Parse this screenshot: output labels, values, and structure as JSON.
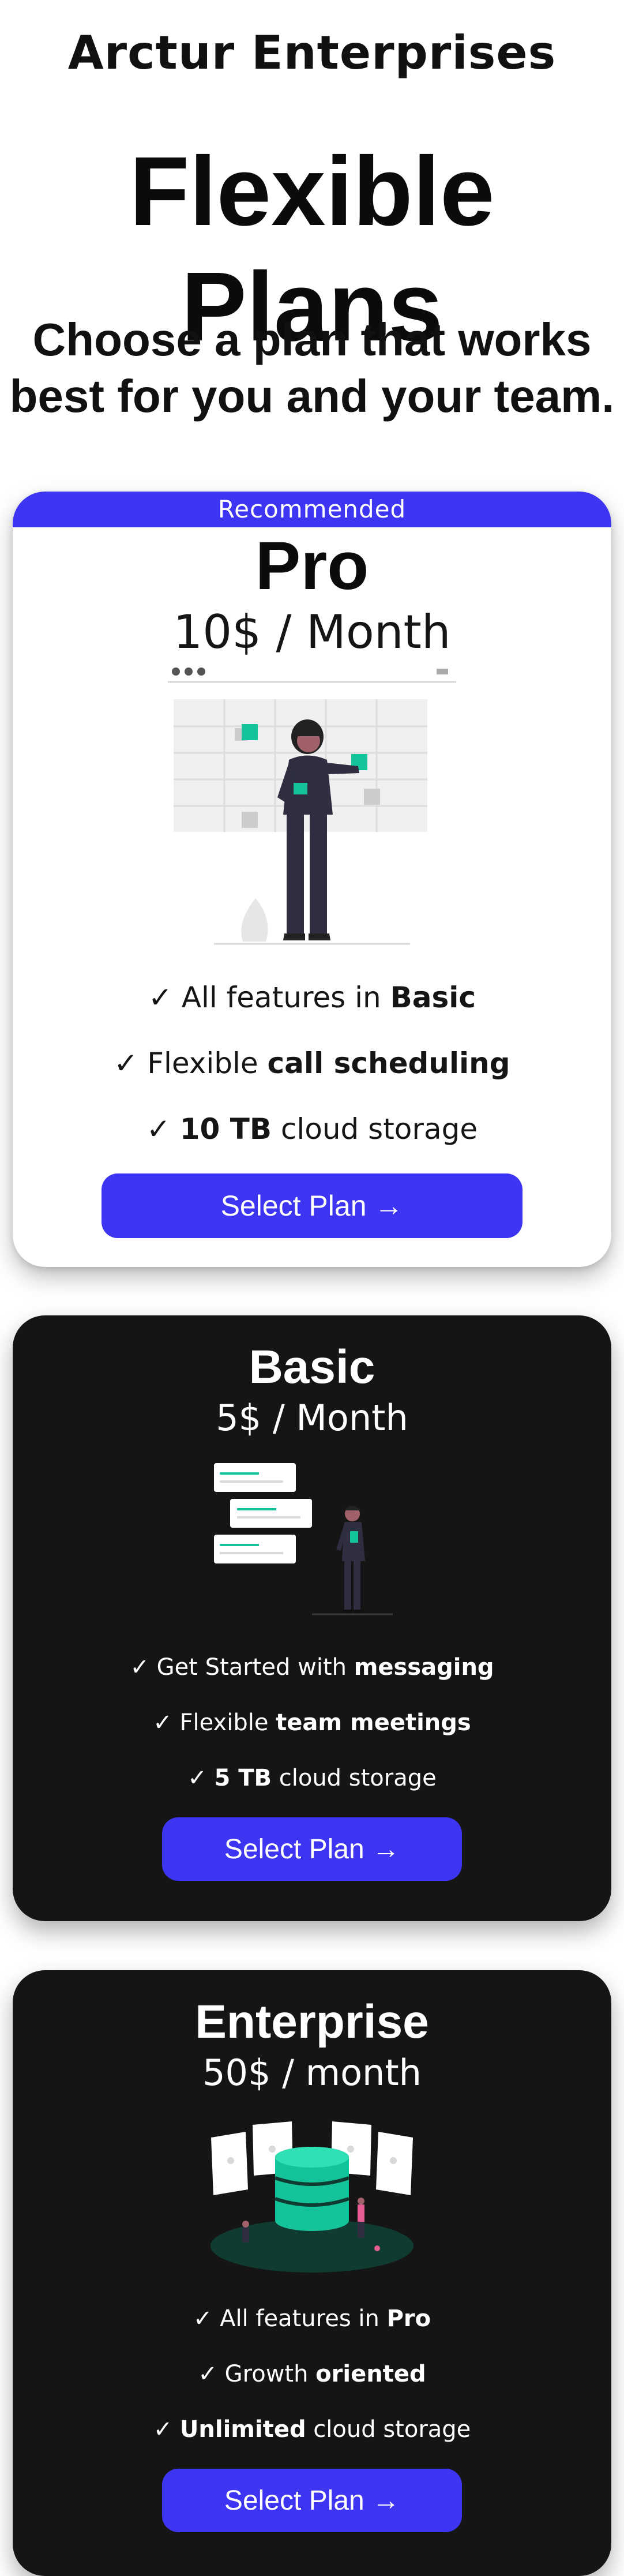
{
  "brand": "Arctur Enterprises",
  "hero_title": "Flexible Plans",
  "subtitle_line1": "Choose a plan that works",
  "subtitle_line2": "best for you and your team.",
  "colors": {
    "accent": "#3d35f2",
    "teal": "#15c39a",
    "dark_card": "#151515"
  },
  "plans": [
    {
      "badge": "Recommended",
      "name": "Pro",
      "price": "10$ / Month",
      "illustration": "woman-presenting-board-illustration",
      "features": [
        {
          "check": "✓",
          "pre": "All features in",
          "bold": "Basic",
          "post": ""
        },
        {
          "check": "✓",
          "pre": "Flexible",
          "bold": "call scheduling",
          "post": ""
        },
        {
          "check": "✓",
          "pre": "",
          "bold": "10 TB",
          "post": "cloud storage"
        }
      ],
      "button": "Select Plan →"
    },
    {
      "name": "Basic",
      "price": "5$ / Month",
      "illustration": "man-messaging-illustration",
      "features": [
        {
          "check": "✓",
          "pre": "Get Started with",
          "bold": "messaging",
          "post": ""
        },
        {
          "check": "✓",
          "pre": "Flexible",
          "bold": "team meetings",
          "post": ""
        },
        {
          "check": "✓",
          "pre": "",
          "bold": "5 TB",
          "post": "cloud storage"
        }
      ],
      "button": "Select Plan →"
    },
    {
      "name": "Enterprise",
      "price": "50$ / month",
      "illustration": "database-server-illustration",
      "features": [
        {
          "check": "✓",
          "pre": "All features in",
          "bold": "Pro",
          "post": ""
        },
        {
          "check": "✓",
          "pre": "Growth",
          "bold": "oriented",
          "post": ""
        },
        {
          "check": "✓",
          "pre": "",
          "bold": "Unlimited",
          "post": "cloud storage"
        }
      ],
      "button": "Select Plan →"
    }
  ]
}
